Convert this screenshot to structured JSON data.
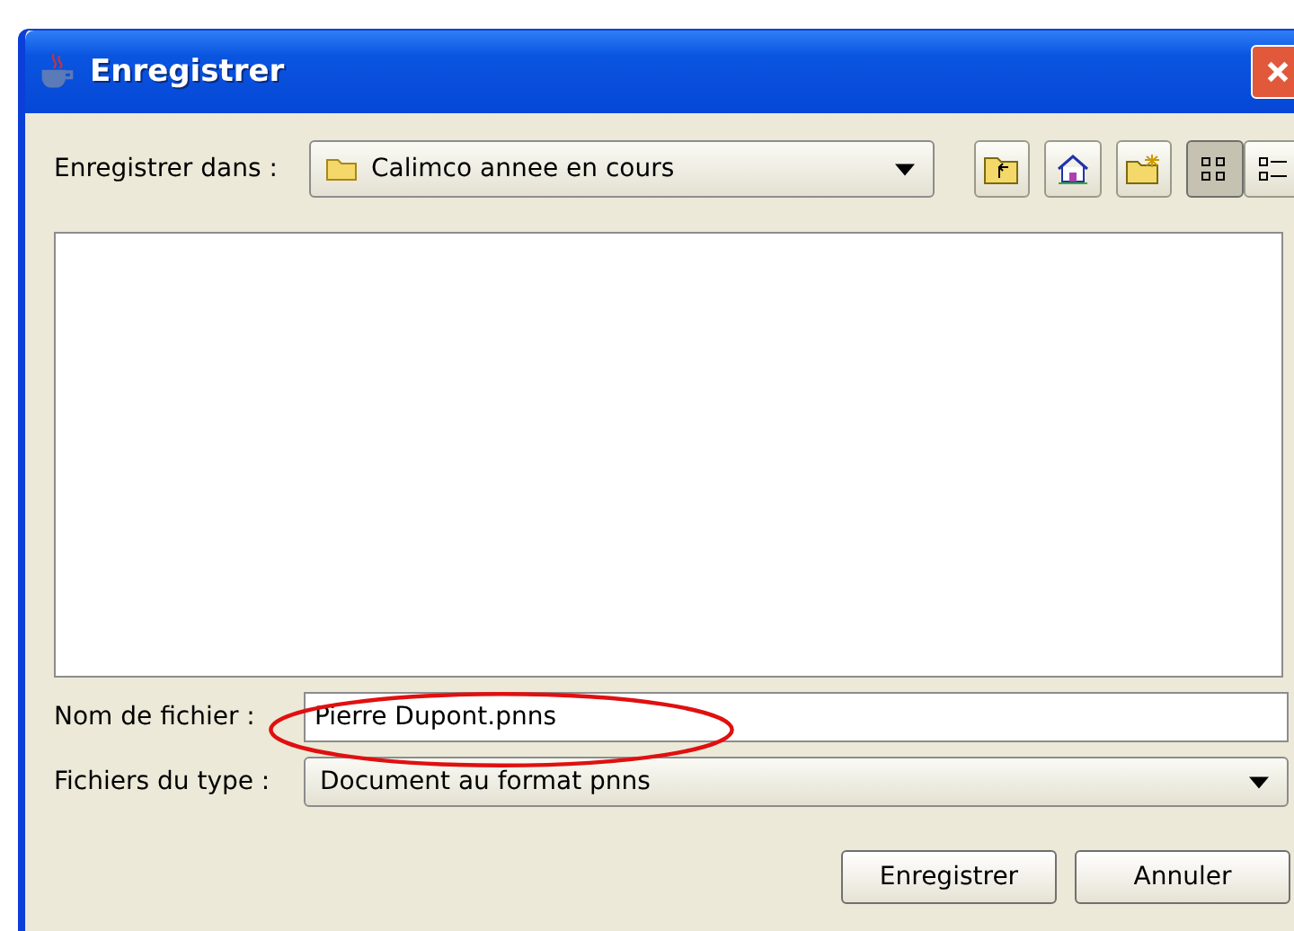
{
  "window": {
    "title": "Enregistrer"
  },
  "look_in": {
    "label": "Enregistrer dans :",
    "value": "Calimco annee en cours"
  },
  "view_buttons": [
    {
      "kind": "list",
      "selected": true
    },
    {
      "kind": "details",
      "selected": false
    }
  ],
  "file_name": {
    "label": "Nom de fichier :",
    "value": "Pierre Dupont.pnns"
  },
  "file_type": {
    "label": "Fichiers du type :",
    "value": "Document au format pnns"
  },
  "buttons": [
    "Enregistrer",
    "Annuler"
  ]
}
